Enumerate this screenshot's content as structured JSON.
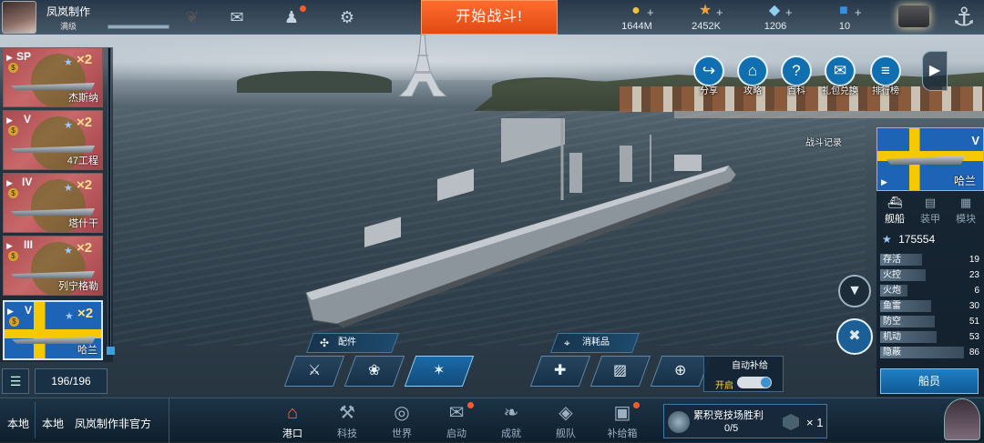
{
  "top": {
    "player_name": "凤岚制作",
    "player_level": "满级",
    "battle_button": "开始战斗!",
    "currencies": [
      {
        "icon": "gold-coin-icon",
        "value": "1644M",
        "color": "#f3c23a"
      },
      {
        "icon": "star-icon",
        "value": "2452K",
        "color": "#f2a23a"
      },
      {
        "icon": "diamond-icon",
        "value": "1206",
        "color": "#8fd0f0"
      },
      {
        "icon": "blue-cube-icon",
        "value": "10",
        "color": "#3a8ee0"
      }
    ],
    "plus": "+"
  },
  "left_list": {
    "ships": [
      {
        "tier": "SP",
        "mult": "×2",
        "name": "杰斯纳"
      },
      {
        "tier": "V",
        "mult": "×2",
        "name": "47工程"
      },
      {
        "tier": "IV",
        "mult": "×2",
        "name": "塔什干"
      },
      {
        "tier": "III",
        "mult": "×2",
        "name": "列宁格勒"
      },
      {
        "tier": "V",
        "mult": "×2",
        "name": "哈兰"
      }
    ],
    "count": "196/196",
    "play_symbol": "▶",
    "star": "★"
  },
  "right_actions": [
    {
      "label": "分享",
      "icon": "share-icon"
    },
    {
      "label": "攻略",
      "icon": "guide-icon"
    },
    {
      "label": "百科",
      "icon": "encyclopedia-icon"
    },
    {
      "label": "礼包兑换",
      "icon": "gift-exchange-icon"
    },
    {
      "label": "排行榜",
      "icon": "leaderboard-icon"
    }
  ],
  "battle_record": "战斗记录",
  "right_panel": {
    "ship_tier": "V",
    "ship_name": "哈兰",
    "tabs": [
      "舰船",
      "装甲",
      "模块"
    ],
    "power": "175554",
    "stats": [
      {
        "label": "存活",
        "value": "19"
      },
      {
        "label": "火控",
        "value": "23"
      },
      {
        "label": "火炮",
        "value": "6"
      },
      {
        "label": "鱼雷",
        "value": "30"
      },
      {
        "label": "防空",
        "value": "51"
      },
      {
        "label": "机动",
        "value": "53"
      },
      {
        "label": "隐蔽",
        "value": "86"
      }
    ],
    "crew_button": "船员"
  },
  "equipment": {
    "parts_title": "配件",
    "consumables_title": "消耗品",
    "auto_supply": "自动补给",
    "auto_supply_state": "开启"
  },
  "bottom": {
    "chat_tab1": "本地",
    "chat_tab2": "本地",
    "chat_text": "凤岚制作非官方",
    "nav": [
      {
        "label": "港口",
        "icon": "port-icon"
      },
      {
        "label": "科技",
        "icon": "tech-icon"
      },
      {
        "label": "世界",
        "icon": "world-icon"
      },
      {
        "label": "启动",
        "icon": "launch-icon"
      },
      {
        "label": "成就",
        "icon": "achievement-icon"
      },
      {
        "label": "舰队",
        "icon": "fleet-icon"
      },
      {
        "label": "补给箱",
        "icon": "supply-box-icon"
      }
    ],
    "arena_title": "累积竞技场胜利",
    "arena_progress": "0/5",
    "arena_reward": "× 1"
  }
}
